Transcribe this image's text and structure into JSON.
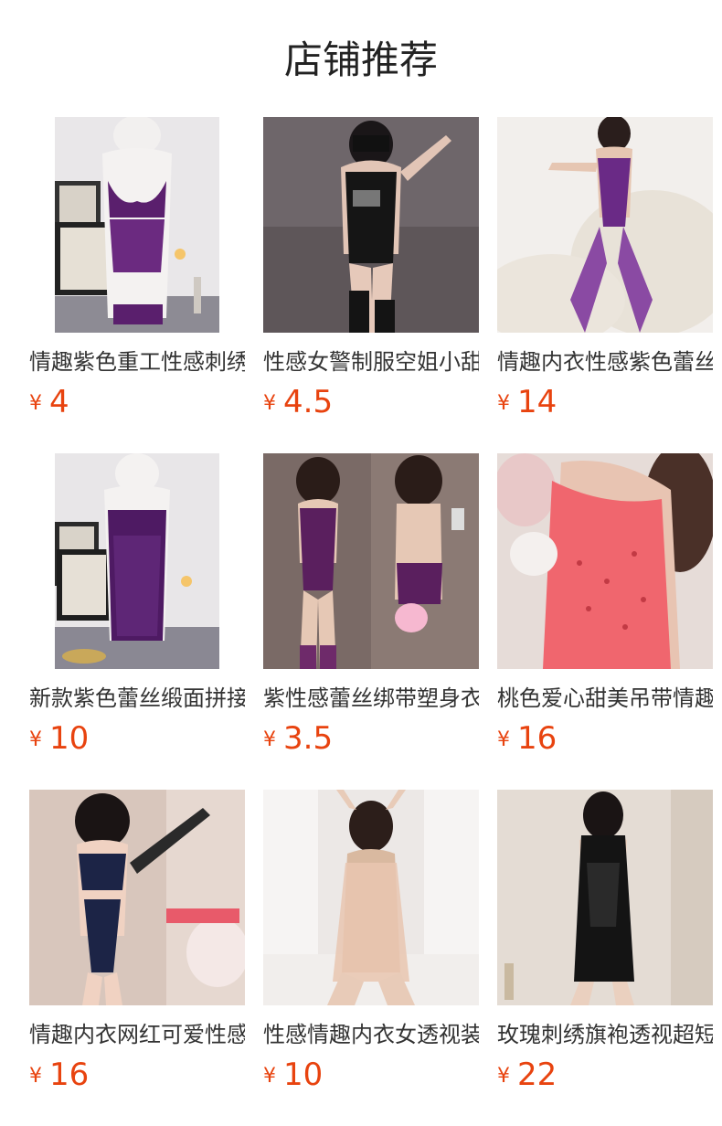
{
  "section_title": "店铺推荐",
  "currency": "¥",
  "products": [
    {
      "name": "情趣紫色重工性感刺绣",
      "price": "4",
      "image": "purple-lace-bodysuit-mannequin-photo"
    },
    {
      "name": "性感女警制服空姐小甜",
      "price": "4.5",
      "image": "black-uniform-bodysuit-model-photo"
    },
    {
      "name": "情趣内衣性感紫色蕾丝",
      "price": "14",
      "image": "purple-lace-stockings-model-photo"
    },
    {
      "name": "新款紫色蕾丝缎面拼接",
      "price": "10",
      "image": "purple-lace-dress-mannequin-photo"
    },
    {
      "name": "紫性感蕾丝绑带塑身衣",
      "price": "3.5",
      "image": "purple-lace-bodysuit-model-photo"
    },
    {
      "name": "桃色爱心甜美吊带情趣",
      "price": "16",
      "image": "pink-heart-slip-dress-model-photo"
    },
    {
      "name": "情趣内衣网红可爱性感",
      "price": "16",
      "image": "navy-swimsuit-cosplay-model-photo"
    },
    {
      "name": "性感情趣内衣女透视装",
      "price": "10",
      "image": "sheer-champagne-nightgown-model-photo"
    },
    {
      "name": "玫瑰刺绣旗袍透视超短",
      "price": "22",
      "image": "black-lace-qipao-model-photo"
    }
  ]
}
